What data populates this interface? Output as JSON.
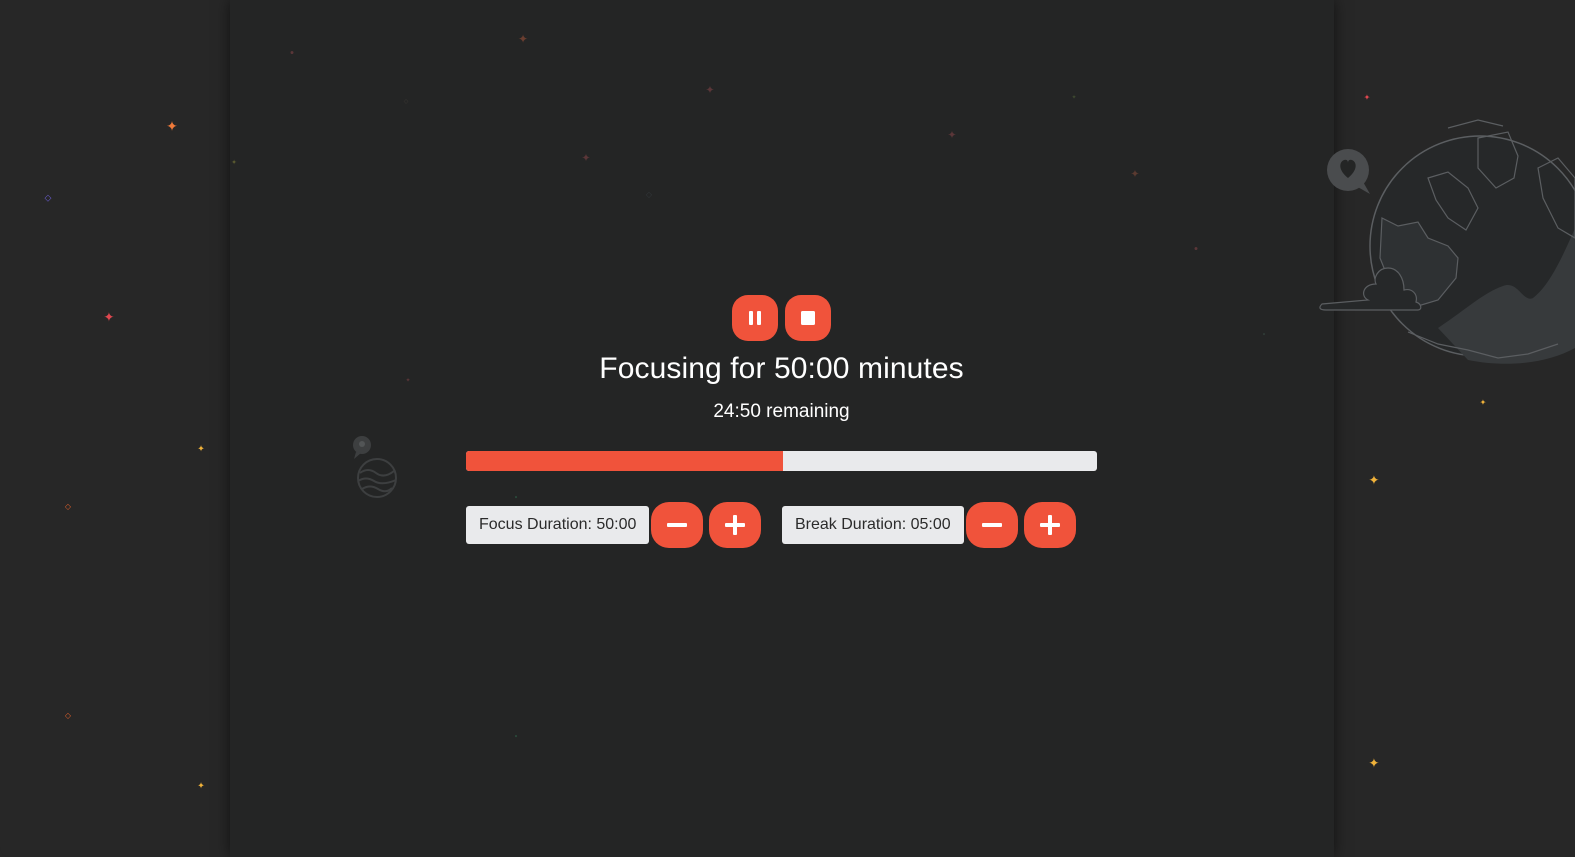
{
  "timer": {
    "title": "Focusing for 50:00 minutes",
    "remaining": "24:50 remaining",
    "progress_fraction": 0.503
  },
  "controls": {
    "pause_icon": "pause-icon",
    "stop_icon": "stop-icon"
  },
  "focus": {
    "label": "Focus Duration: 50:00",
    "decrease_icon": "minus-icon",
    "increase_icon": "plus-icon"
  },
  "break": {
    "label": "Break Duration: 05:00",
    "decrease_icon": "minus-icon",
    "increase_icon": "plus-icon"
  },
  "decorations": {
    "right_illustration": "globe-with-heart-bubble-icon",
    "left_illustration": "small-planet-with-bubble-icon"
  },
  "colors": {
    "accent": "#f0533b",
    "background": "#242525",
    "track": "#e9eaec",
    "text": "#ffffff"
  }
}
